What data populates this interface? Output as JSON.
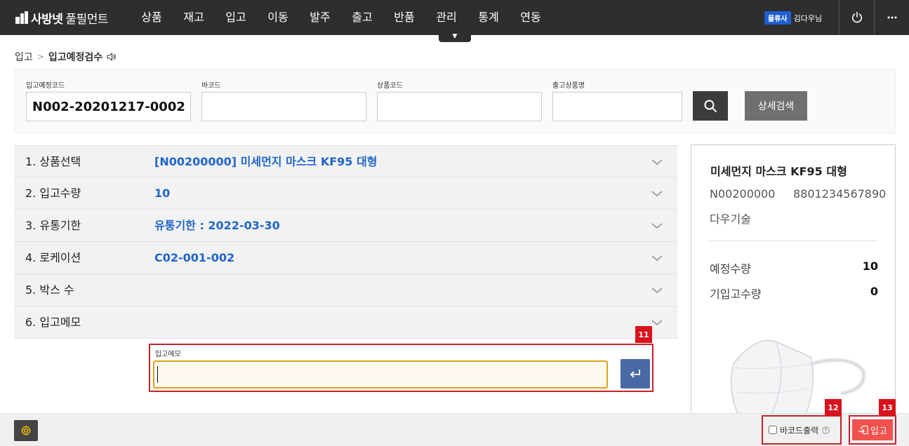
{
  "app": {
    "logo_bold": "사방넷",
    "logo_text": "풀필먼트"
  },
  "nav": {
    "items": [
      "상품",
      "재고",
      "입고",
      "이동",
      "발주",
      "출고",
      "반품",
      "관리",
      "통계",
      "연동"
    ],
    "toggle_glyph": "▼"
  },
  "user": {
    "badge": "물류사",
    "name": "김다우님"
  },
  "breadcrumb": {
    "parent": "입고",
    "current": "입고예정검수"
  },
  "search": {
    "fields": [
      {
        "label": "입고예정코드",
        "value": "N002-20201217-0002"
      },
      {
        "label": "바코드",
        "value": ""
      },
      {
        "label": "상품코드",
        "value": ""
      },
      {
        "label": "출고상품명",
        "value": ""
      }
    ],
    "detail_label": "상세검색"
  },
  "steps": [
    {
      "label": "1. 상품선택",
      "value": "[N00200000] 미세먼지 마스크 KF95 대형"
    },
    {
      "label": "2. 입고수량",
      "value": "10"
    },
    {
      "label": "3. 유통기한",
      "value": "유통기한 : 2022-03-30"
    },
    {
      "label": "4. 로케이션",
      "value": "C02-001-002"
    },
    {
      "label": "5. 박스 수",
      "value": ""
    },
    {
      "label": "6. 입고메모",
      "value": ""
    }
  ],
  "memo": {
    "label": "입고메모",
    "value": ""
  },
  "markers": {
    "memo": "11",
    "barcode": "12",
    "submit": "13"
  },
  "product": {
    "name": "미세먼지 마스크 KF95 대형",
    "code": "N00200000",
    "barcode": "8801234567890",
    "maker": "다우기술",
    "planned_label": "예정수량",
    "planned_value": "10",
    "received_label": "기입고수량",
    "received_value": "0"
  },
  "footer": {
    "barcode_print_label": "바코드출력",
    "barcode_print_checked": false,
    "submit_label": "입고"
  },
  "colors": {
    "topbar": "#2e2e2e",
    "accent_blue": "#1f66c8",
    "highlight_red": "#c9202a",
    "submit": "#f2524e"
  }
}
